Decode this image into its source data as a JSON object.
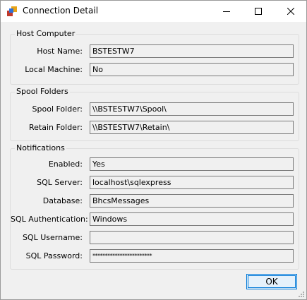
{
  "window": {
    "title": "Connection Detail",
    "icon": "app-icon"
  },
  "groups": {
    "host": {
      "label": "Host Computer",
      "fields": [
        {
          "label": "Host Name:",
          "value": "BSTESTW7"
        },
        {
          "label": "Local Machine:",
          "value": "No"
        }
      ]
    },
    "spool": {
      "label": "Spool Folders",
      "fields": [
        {
          "label": "Spool Folder:",
          "value": "\\\\BSTESTW7\\Spool\\"
        },
        {
          "label": "Retain Folder:",
          "value": "\\\\BSTESTW7\\Retain\\"
        }
      ]
    },
    "notifications": {
      "label": "Notifications",
      "fields": [
        {
          "label": "Enabled:",
          "value": "Yes"
        },
        {
          "label": "SQL Server:",
          "value": "localhost\\sqlexpress"
        },
        {
          "label": "Database:",
          "value": "BhcsMessages"
        },
        {
          "label": "SQL Authentication:",
          "value": "Windows"
        },
        {
          "label": "SQL Username:",
          "value": ""
        },
        {
          "label": "SQL Password:",
          "value": "************************"
        }
      ]
    }
  },
  "buttons": {
    "ok": "OK"
  }
}
